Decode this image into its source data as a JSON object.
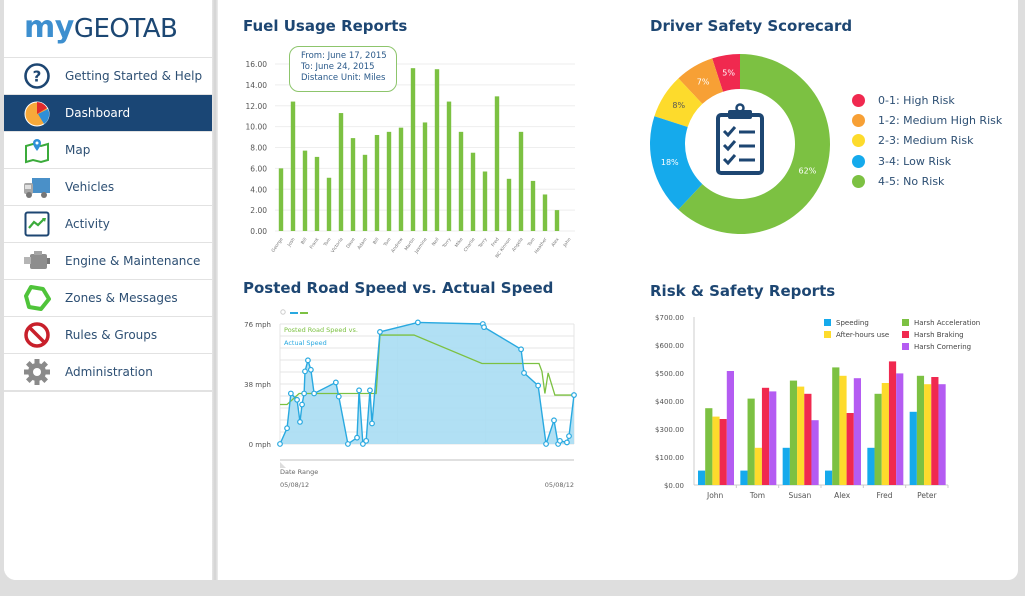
{
  "app": {
    "logo_my": "my",
    "logo_geotab": "GEOTAB"
  },
  "sidebar": {
    "items": [
      {
        "label": "Getting Started & Help",
        "icon": "help-icon",
        "active": false
      },
      {
        "label": "Dashboard",
        "icon": "dashboard-pie-icon",
        "active": true
      },
      {
        "label": "Map",
        "icon": "map-icon",
        "active": false
      },
      {
        "label": "Vehicles",
        "icon": "truck-icon",
        "active": false
      },
      {
        "label": "Activity",
        "icon": "activity-chart-icon",
        "active": false
      },
      {
        "label": "Engine & Maintenance",
        "icon": "engine-icon",
        "active": false
      },
      {
        "label": "Zones & Messages",
        "icon": "zone-polygon-icon",
        "active": false
      },
      {
        "label": "Rules & Groups",
        "icon": "prohibited-icon",
        "active": false
      },
      {
        "label": "Administration",
        "icon": "gear-icon",
        "active": false
      }
    ]
  },
  "fuel": {
    "title": "Fuel Usage Reports",
    "tooltip": {
      "from": "From: June 17, 2015",
      "to": "To: June 24, 2015",
      "unit": "Distance Unit: Miles"
    }
  },
  "safety": {
    "title": "Driver Safety Scorecard"
  },
  "speed": {
    "title": "Posted Road Speed vs. Actual Speed"
  },
  "risk": {
    "title": "Risk & Safety Reports"
  },
  "chart_data": [
    {
      "type": "bar",
      "title": "Fuel Usage Reports",
      "categories": [
        "George",
        "Josh",
        "Bill",
        "Frank",
        "Tom",
        "Victoria",
        "Dave",
        "Adam",
        "Bill",
        "Tom",
        "Andrew",
        "Martin",
        "Jasmine",
        "Neil",
        "Torry",
        "Mike",
        "Charlie",
        "Terry",
        "Fred",
        "NC Kinnon",
        "Angela",
        "Tom",
        "Heather",
        "Alex",
        "John"
      ],
      "values": [
        6.0,
        12.4,
        7.7,
        7.1,
        5.1,
        11.3,
        8.9,
        7.3,
        9.2,
        9.5,
        9.9,
        15.6,
        10.4,
        15.5,
        12.4,
        9.5,
        7.5,
        5.7,
        12.9,
        5.0,
        9.5,
        4.8,
        3.5,
        2.0,
        0
      ],
      "ylim": [
        0,
        16
      ],
      "yticks": [
        "0.00",
        "2.00",
        "4.00",
        "6.00",
        "8.00",
        "10.00",
        "12.00",
        "14.00",
        "16.00"
      ],
      "color": "#7cc142",
      "grid": true
    },
    {
      "type": "pie",
      "title": "Driver Safety Scorecard",
      "donut": true,
      "center_icon": "clipboard-checklist-icon",
      "slices": [
        {
          "label": "0-1: High Risk",
          "value": 5,
          "text": "5%",
          "color": "#f0294f"
        },
        {
          "label": "1-2: Medium High Risk",
          "value": 7,
          "text": "7%",
          "color": "#f7a035"
        },
        {
          "label": "2-3: Medium Risk",
          "value": 8,
          "text": "8%",
          "color": "#fddb2c"
        },
        {
          "label": "3-4: Low Risk",
          "value": 18,
          "text": "18%",
          "color": "#15aaec"
        },
        {
          "label": "4-5: No Risk",
          "value": 62,
          "text": "62%",
          "color": "#7cc142"
        }
      ],
      "legend": "right"
    },
    {
      "type": "area",
      "title": "Posted Road Speed vs. Actual Speed",
      "ylabels": [
        "76 mph",
        "38 mph",
        "0 mph"
      ],
      "ylim": [
        0,
        76
      ],
      "xlim": [
        0,
        100
      ],
      "legend_text": [
        "Posted Road Speed vs.",
        "Actual Speed"
      ],
      "range_label": "Date Range",
      "x_start": "05/08/12",
      "x_end": "05/08/12",
      "series": [
        {
          "name": "Actual Speed",
          "color": "#29a9e0",
          "points": [
            [
              0,
              0
            ],
            [
              2.4,
              10
            ],
            [
              3.7,
              32
            ],
            [
              5.8,
              28
            ],
            [
              6.8,
              14
            ],
            [
              7.5,
              25
            ],
            [
              8.2,
              32
            ],
            [
              8.5,
              46
            ],
            [
              9.5,
              53
            ],
            [
              10.5,
              47
            ],
            [
              11.6,
              32
            ],
            [
              19,
              39
            ],
            [
              20,
              30
            ],
            [
              23.1,
              0
            ],
            [
              26.2,
              4
            ],
            [
              26.9,
              34
            ],
            [
              28.2,
              0
            ],
            [
              29.3,
              2
            ],
            [
              30.6,
              34
            ],
            [
              31.3,
              13
            ],
            [
              34,
              71
            ],
            [
              46.9,
              77
            ],
            [
              69,
              76
            ],
            [
              69.4,
              74
            ],
            [
              82,
              60
            ],
            [
              83,
              45
            ],
            [
              87.8,
              37
            ],
            [
              90.5,
              0
            ],
            [
              93.2,
              15
            ],
            [
              94.6,
              0
            ],
            [
              95.2,
              2
            ],
            [
              97.6,
              1
            ],
            [
              98.3,
              5
            ],
            [
              100,
              31
            ]
          ]
        },
        {
          "name": "Posted Road Speed",
          "color": "#7cc142",
          "points": [
            [
              0,
              25
            ],
            [
              2.4,
              25
            ],
            [
              6.5,
              32
            ],
            [
              32.7,
              32
            ],
            [
              33.3,
              49
            ],
            [
              34,
              69
            ],
            [
              45.6,
              69
            ],
            [
              68.7,
              51
            ],
            [
              88.1,
              51
            ],
            [
              89.1,
              46
            ],
            [
              90.1,
              32
            ],
            [
              91.2,
              45
            ],
            [
              93.5,
              31
            ],
            [
              100,
              31
            ]
          ]
        }
      ]
    },
    {
      "type": "bar",
      "title": "Risk & Safety Reports",
      "categories": [
        "John",
        "Tom",
        "Susan",
        "Alex",
        "Fred",
        "Peter"
      ],
      "yticks": [
        "$0.00",
        "$100.00",
        "$300.00",
        "$400.00",
        "$500.00",
        "$600.00",
        "$700.00"
      ],
      "ylim": [
        0,
        700
      ],
      "legend": "top-right",
      "series": [
        {
          "name": "Speeding",
          "color": "#15aaec",
          "values": [
            60,
            60,
            155,
            60,
            155,
            305
          ]
        },
        {
          "name": "Harsh Acceleration",
          "color": "#7cc142",
          "values": [
            320,
            360,
            435,
            490,
            380,
            455
          ]
        },
        {
          "name": "After-hours use",
          "color": "#fddb2c",
          "values": [
            285,
            155,
            410,
            455,
            425,
            420
          ]
        },
        {
          "name": "Harsh Braking",
          "color": "#f0294f",
          "values": [
            275,
            405,
            380,
            300,
            515,
            450
          ]
        },
        {
          "name": "Harsh Cornering",
          "color": "#b45cf2",
          "values": [
            475,
            390,
            270,
            445,
            465,
            420
          ]
        }
      ]
    }
  ]
}
